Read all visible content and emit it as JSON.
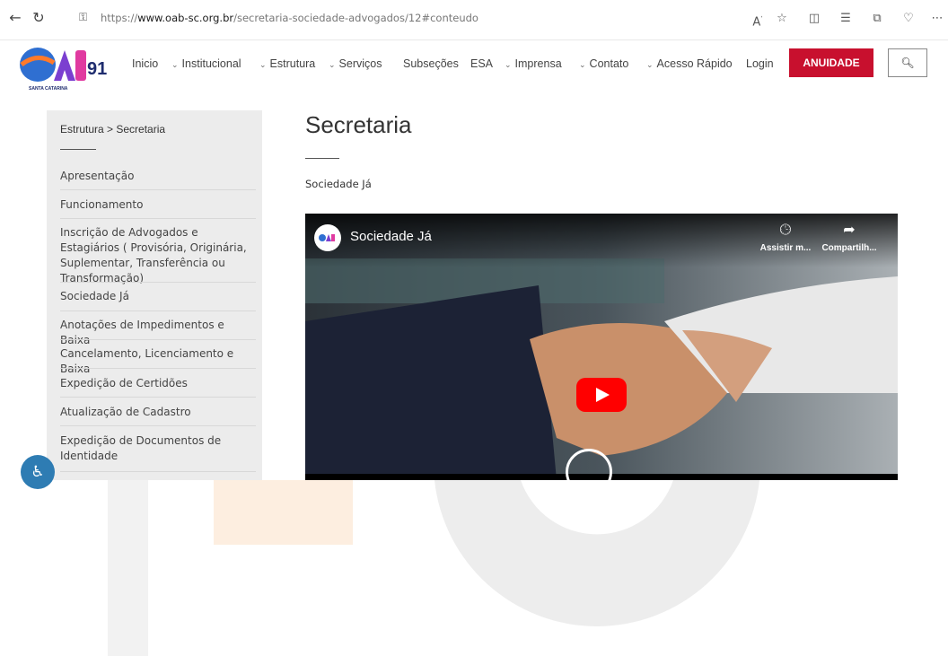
{
  "browser": {
    "url_prefix": "https://",
    "url_domain": "www.oab-sc.org.br",
    "url_path": "/secretaria-sociedade-advogados/12#conteudo",
    "back_icon": "back-arrow-icon",
    "reload_icon": "reload-icon",
    "lock_icon": "lock-icon",
    "toolbar_icons": [
      "read-aloud-icon",
      "favorite-star-icon",
      "split-screen-icon",
      "favorites-list-icon",
      "collections-icon",
      "browser-essentials-icon",
      "more-icon"
    ]
  },
  "header": {
    "logo_text": "OAB",
    "logo_number": "91",
    "logo_sub": "SANTA CATARINA",
    "menu": [
      {
        "label": "Inicio",
        "chevron": false
      },
      {
        "label": "Institucional",
        "chevron": true
      },
      {
        "label": "Estrutura",
        "chevron": true
      },
      {
        "label": "Serviços",
        "chevron": true
      },
      {
        "label": "Subseções",
        "chevron": false
      },
      {
        "label": "ESA",
        "chevron": false
      },
      {
        "label": "Imprensa",
        "chevron": true
      },
      {
        "label": "Contato",
        "chevron": true
      },
      {
        "label": "Acesso Rápido",
        "chevron": true
      },
      {
        "label": "Login",
        "chevron": false
      }
    ],
    "anuidade_label": "ANUIDADE",
    "accent_color": "#c8102e"
  },
  "sidebar": {
    "breadcrumb": "Estrutura > Secretaria",
    "items": [
      "Apresentação",
      "Funcionamento",
      "Inscrição de Advogados e Estagiários ( Provisória, Originária, Suplementar, Transferência ou Transformação)",
      "Sociedade Já",
      "Anotações de Impedimentos e Baixa",
      "Cancelamento, Licenciamento e Baixa",
      "Expedição de Certidões",
      "Atualização de Cadastro",
      "Expedição de Documentos de Identidade"
    ]
  },
  "main": {
    "title": "Secretaria",
    "subtitle": "Sociedade Já",
    "video": {
      "title": "Sociedade Já",
      "watch_later_label": "Assistir m...",
      "share_label": "Compartilh...",
      "play_color": "#ff0000"
    }
  },
  "accessibility_icon": "accessibility-icon"
}
